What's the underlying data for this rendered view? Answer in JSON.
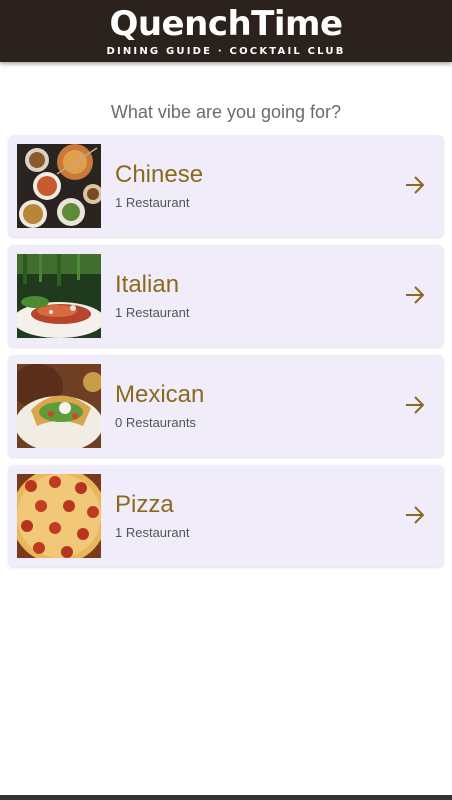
{
  "header": {
    "logo_text": "QuenchTime",
    "logo_subtitle": "DINING GUIDE  ·  COCKTAIL CLUB",
    "background_color": "#2b211d"
  },
  "main": {
    "prompt": "What vibe are you going for?",
    "categories": [
      {
        "name": "Chinese",
        "count_label": "1 Restaurant",
        "image": "chinese-food-image",
        "icon": "arrow-right-icon"
      },
      {
        "name": "Italian",
        "count_label": "1 Restaurant",
        "image": "italian-food-image",
        "icon": "arrow-right-icon"
      },
      {
        "name": "Mexican",
        "count_label": "0 Restaurants",
        "image": "mexican-food-image",
        "icon": "arrow-right-icon"
      },
      {
        "name": "Pizza",
        "count_label": "1 Restaurant",
        "image": "pizza-image",
        "icon": "arrow-right-icon"
      }
    ]
  },
  "colors": {
    "card_background": "#f1ecfa",
    "accent_gold": "#8a6a1d",
    "subtext": "#555555"
  }
}
